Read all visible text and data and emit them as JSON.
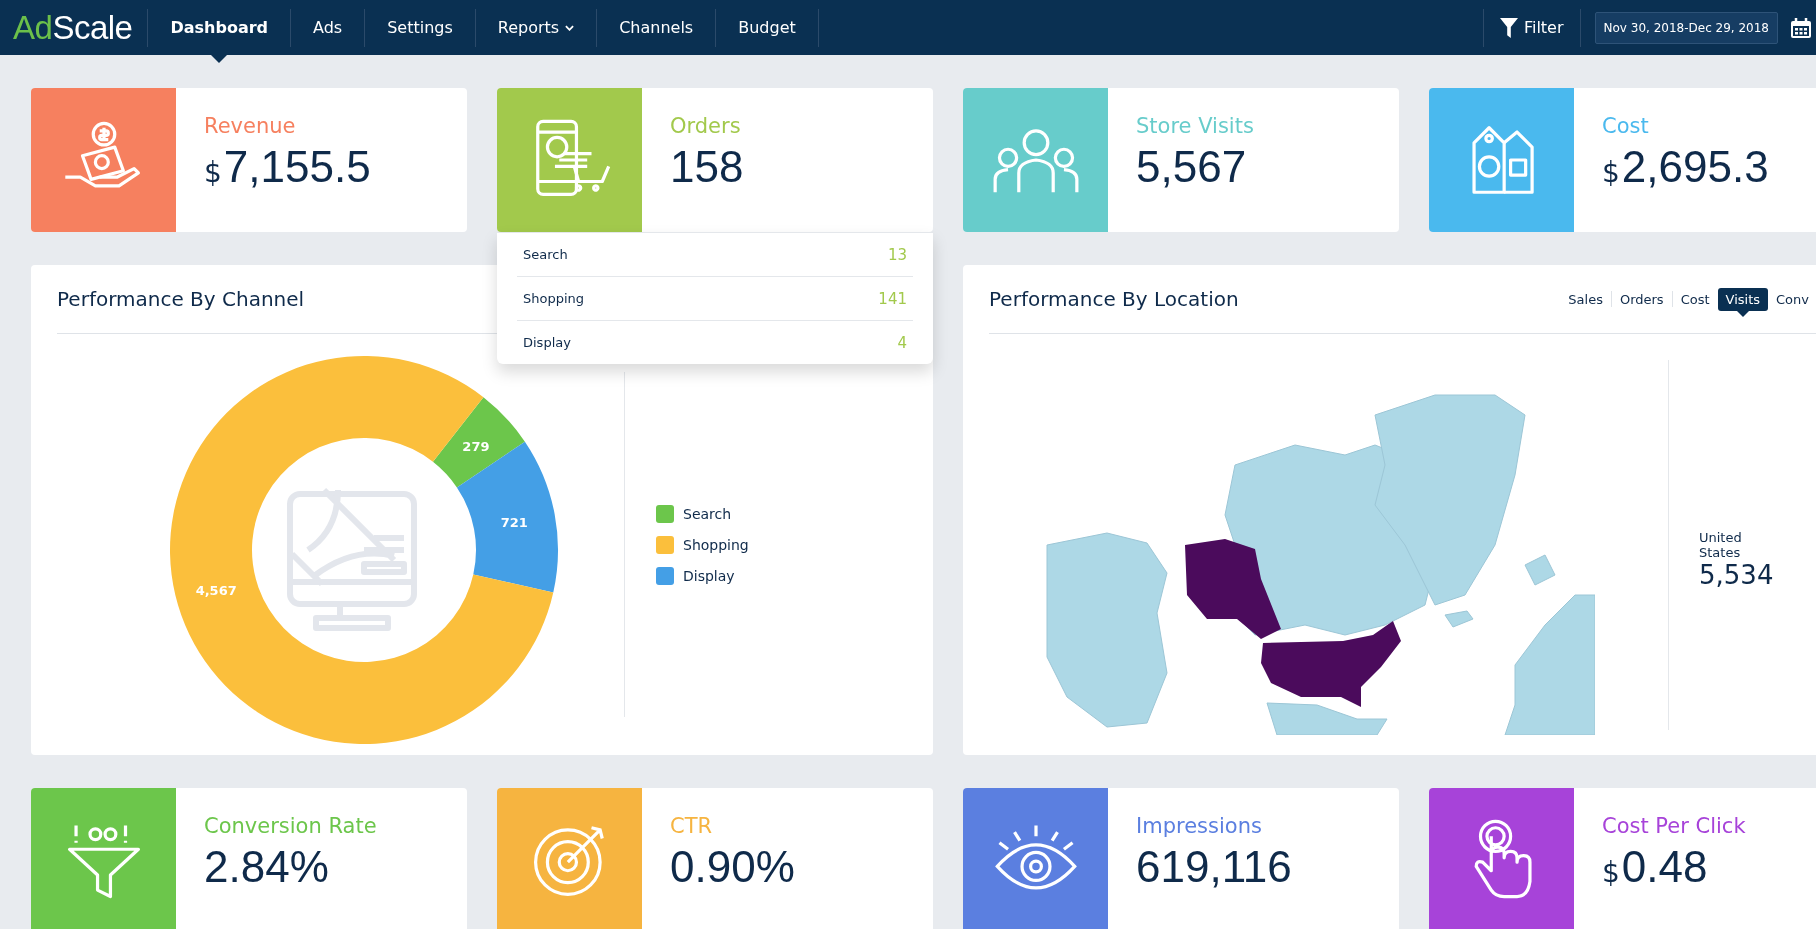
{
  "header": {
    "logo_prefix": "Ad",
    "logo_suffix": "Scale",
    "nav": [
      {
        "label": "Dashboard",
        "selected": true,
        "has_menu": false
      },
      {
        "label": "Ads",
        "selected": false,
        "has_menu": false
      },
      {
        "label": "Settings",
        "selected": false,
        "has_menu": false
      },
      {
        "label": "Reports",
        "selected": false,
        "has_menu": true
      },
      {
        "label": "Channels",
        "selected": false,
        "has_menu": false
      },
      {
        "label": "Budget",
        "selected": false,
        "has_menu": false
      }
    ],
    "filter_label": "Filter",
    "date_range": "Nov 30, 2018-Dec 29, 2018"
  },
  "top_stats": [
    {
      "kind": "revenue",
      "label": "Revenue",
      "currency": "$",
      "value": "7,155.5",
      "color": "#f6805f"
    },
    {
      "kind": "orders",
      "label": "Orders",
      "value": "158",
      "color": "#a2c94c",
      "breakdown": [
        {
          "label": "Search",
          "value": "13"
        },
        {
          "label": "Shopping",
          "value": "141"
        },
        {
          "label": "Display",
          "value": "4"
        }
      ]
    },
    {
      "kind": "visits",
      "label": "Store Visits",
      "value": "5,567",
      "color": "#67cccb"
    },
    {
      "kind": "cost",
      "label": "Cost",
      "currency": "$",
      "value": "2,695.3",
      "color": "#4ab9ee"
    }
  ],
  "channel_panel": {
    "title": "Performance By Channel",
    "chart_data": {
      "type": "donut",
      "categories": [
        "Search",
        "Shopping",
        "Display"
      ],
      "values": [
        279,
        4567,
        721
      ],
      "colors": [
        "#6cc64b",
        "#fbbf3c",
        "#449fe6"
      ],
      "value_labels": [
        "279",
        "4,567",
        "721"
      ],
      "legend": true
    }
  },
  "location_panel": {
    "title": "Performance By Location",
    "tabs": [
      {
        "label": "Sales",
        "selected": false
      },
      {
        "label": "Orders",
        "selected": false
      },
      {
        "label": "Cost",
        "selected": false
      },
      {
        "label": "Visits",
        "selected": true
      },
      {
        "label": "Conv",
        "selected": false
      }
    ],
    "country": "United States",
    "country_value": "5,534"
  },
  "bottom_stats": [
    {
      "kind": "conversion",
      "label": "Conversion Rate",
      "value": "2.84%",
      "color": "#6cc64b"
    },
    {
      "kind": "ctr",
      "label": "CTR",
      "value": "0.90%",
      "color": "#f6b440"
    },
    {
      "kind": "impressions",
      "label": "Impressions",
      "value": "619,116",
      "color": "#5b7fe0"
    },
    {
      "kind": "cpc",
      "label": "Cost Per Click",
      "currency": "$",
      "value": "0.48",
      "color": "#a743d9"
    }
  ]
}
